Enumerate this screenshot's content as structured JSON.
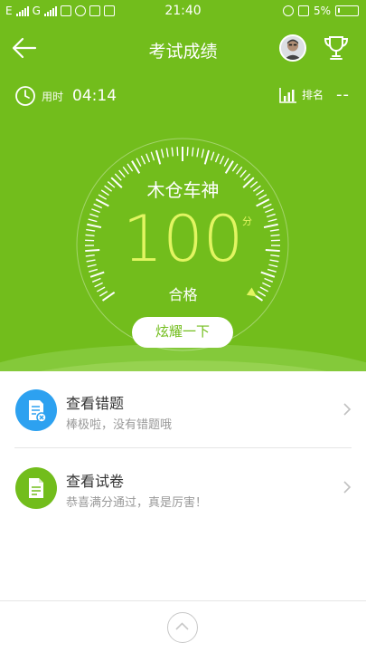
{
  "status_bar": {
    "carrier_1": "E",
    "carrier_2": "G",
    "time": "21:40",
    "battery": "5%"
  },
  "header": {
    "title": "考试成绩",
    "back_icon": "back-arrow-icon",
    "trophy_icon": "trophy-icon"
  },
  "stats": {
    "time_label": "用时",
    "time_value": "04:14",
    "rank_label": "排名",
    "rank_value": "--"
  },
  "gauge": {
    "title": "木仓车神",
    "score": "100",
    "unit": "分",
    "result": "合格",
    "fill_fraction": 1.0
  },
  "share_button": "炫耀一下",
  "list": [
    {
      "title": "查看错题",
      "subtitle": "棒极啦，没有错题哦",
      "icon": "wrong-questions-icon",
      "color": "#2da1f0"
    },
    {
      "title": "查看试卷",
      "subtitle": "恭喜满分通过，真是厉害！",
      "icon": "exam-paper-icon",
      "color": "#72bd1c"
    }
  ],
  "colors": {
    "primary_green": "#72bd1c",
    "score_yellow": "#e2f561",
    "blue": "#2da1f0"
  }
}
